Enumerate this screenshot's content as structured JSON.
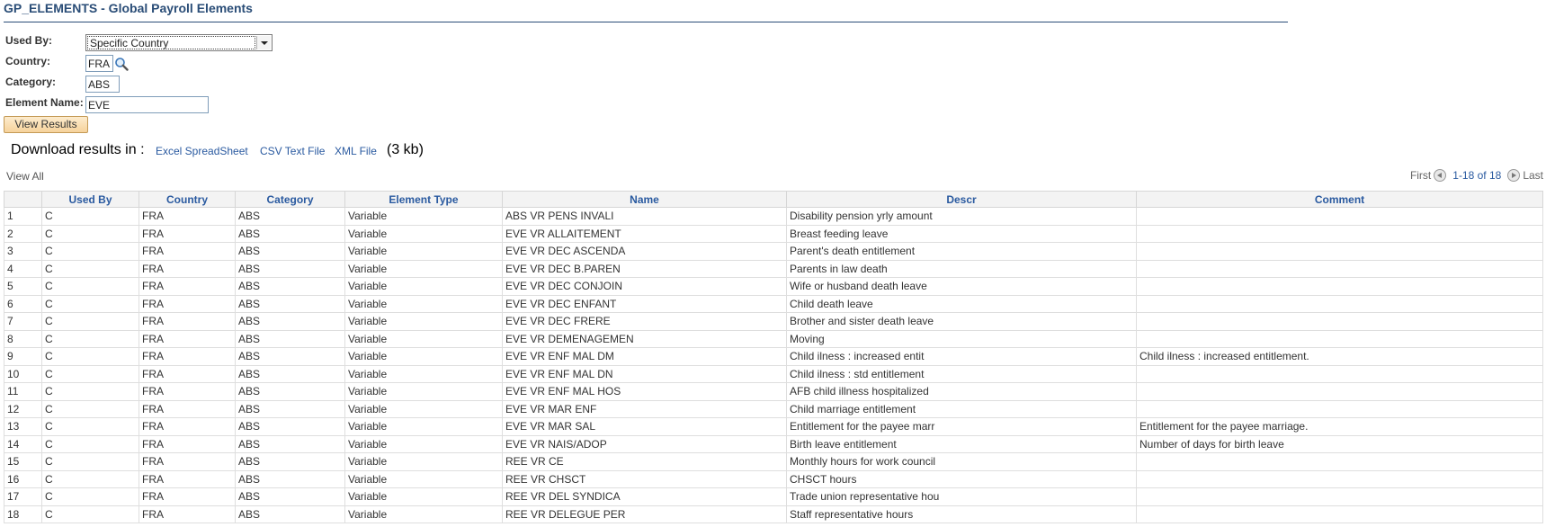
{
  "page": {
    "title": "GP_ELEMENTS - Global Payroll Elements"
  },
  "form": {
    "used_by_label": "Used By:",
    "used_by_value": "Specific Country",
    "country_label": "Country:",
    "country_value": "FRA",
    "category_label": "Category:",
    "category_value": "ABS",
    "element_name_label": "Element Name:",
    "element_name_value": "EVE",
    "view_results_label": "View Results"
  },
  "download": {
    "label": "Download results in :",
    "excel": "Excel SpreadSheet",
    "csv": "CSV Text File",
    "xml": "XML File",
    "size": "(3 kb)"
  },
  "grid": {
    "view_all": "View All",
    "pager": {
      "first": "First",
      "range": "1-18 of 18",
      "last": "Last"
    },
    "columns": [
      "",
      "Used By",
      "Country",
      "Category",
      "Element Type",
      "Name",
      "Descr",
      "Comment"
    ],
    "rows": [
      [
        "1",
        "C",
        "FRA",
        "ABS",
        "Variable",
        "ABS VR PENS INVALI",
        "Disability pension yrly amount",
        ""
      ],
      [
        "2",
        "C",
        "FRA",
        "ABS",
        "Variable",
        "EVE VR ALLAITEMENT",
        "Breast feeding leave",
        ""
      ],
      [
        "3",
        "C",
        "FRA",
        "ABS",
        "Variable",
        "EVE VR DEC ASCENDA",
        "Parent's death entitlement",
        ""
      ],
      [
        "4",
        "C",
        "FRA",
        "ABS",
        "Variable",
        "EVE VR DEC B.PAREN",
        "Parents in law death",
        ""
      ],
      [
        "5",
        "C",
        "FRA",
        "ABS",
        "Variable",
        "EVE VR DEC CONJOIN",
        "Wife or husband death leave",
        ""
      ],
      [
        "6",
        "C",
        "FRA",
        "ABS",
        "Variable",
        "EVE VR DEC ENFANT",
        "Child death leave",
        ""
      ],
      [
        "7",
        "C",
        "FRA",
        "ABS",
        "Variable",
        "EVE VR DEC FRERE",
        "Brother and sister death leave",
        ""
      ],
      [
        "8",
        "C",
        "FRA",
        "ABS",
        "Variable",
        "EVE VR DEMENAGEMEN",
        "Moving",
        ""
      ],
      [
        "9",
        "C",
        "FRA",
        "ABS",
        "Variable",
        "EVE VR ENF MAL DM",
        "Child ilness : increased entit",
        "Child ilness : increased entitlement."
      ],
      [
        "10",
        "C",
        "FRA",
        "ABS",
        "Variable",
        "EVE VR ENF MAL DN",
        "Child ilness : std entitlement",
        ""
      ],
      [
        "11",
        "C",
        "FRA",
        "ABS",
        "Variable",
        "EVE VR ENF MAL HOS",
        "AFB child illness hospitalized",
        ""
      ],
      [
        "12",
        "C",
        "FRA",
        "ABS",
        "Variable",
        "EVE VR MAR ENF",
        "Child marriage entitlement",
        ""
      ],
      [
        "13",
        "C",
        "FRA",
        "ABS",
        "Variable",
        "EVE VR MAR SAL",
        "Entitlement for the payee marr",
        "Entitlement for the payee marriage."
      ],
      [
        "14",
        "C",
        "FRA",
        "ABS",
        "Variable",
        "EVE VR NAIS/ADOP",
        "Birth leave entitlement",
        "Number of days for birth leave"
      ],
      [
        "15",
        "C",
        "FRA",
        "ABS",
        "Variable",
        "REE VR CE",
        "Monthly hours for work council",
        ""
      ],
      [
        "16",
        "C",
        "FRA",
        "ABS",
        "Variable",
        "REE VR CHSCT",
        "CHSCT hours",
        ""
      ],
      [
        "17",
        "C",
        "FRA",
        "ABS",
        "Variable",
        "REE VR DEL SYNDICA",
        "Trade union representative hou",
        ""
      ],
      [
        "18",
        "C",
        "FRA",
        "ABS",
        "Variable",
        "REE VR DELEGUE PER",
        "Staff representative hours",
        ""
      ]
    ]
  }
}
